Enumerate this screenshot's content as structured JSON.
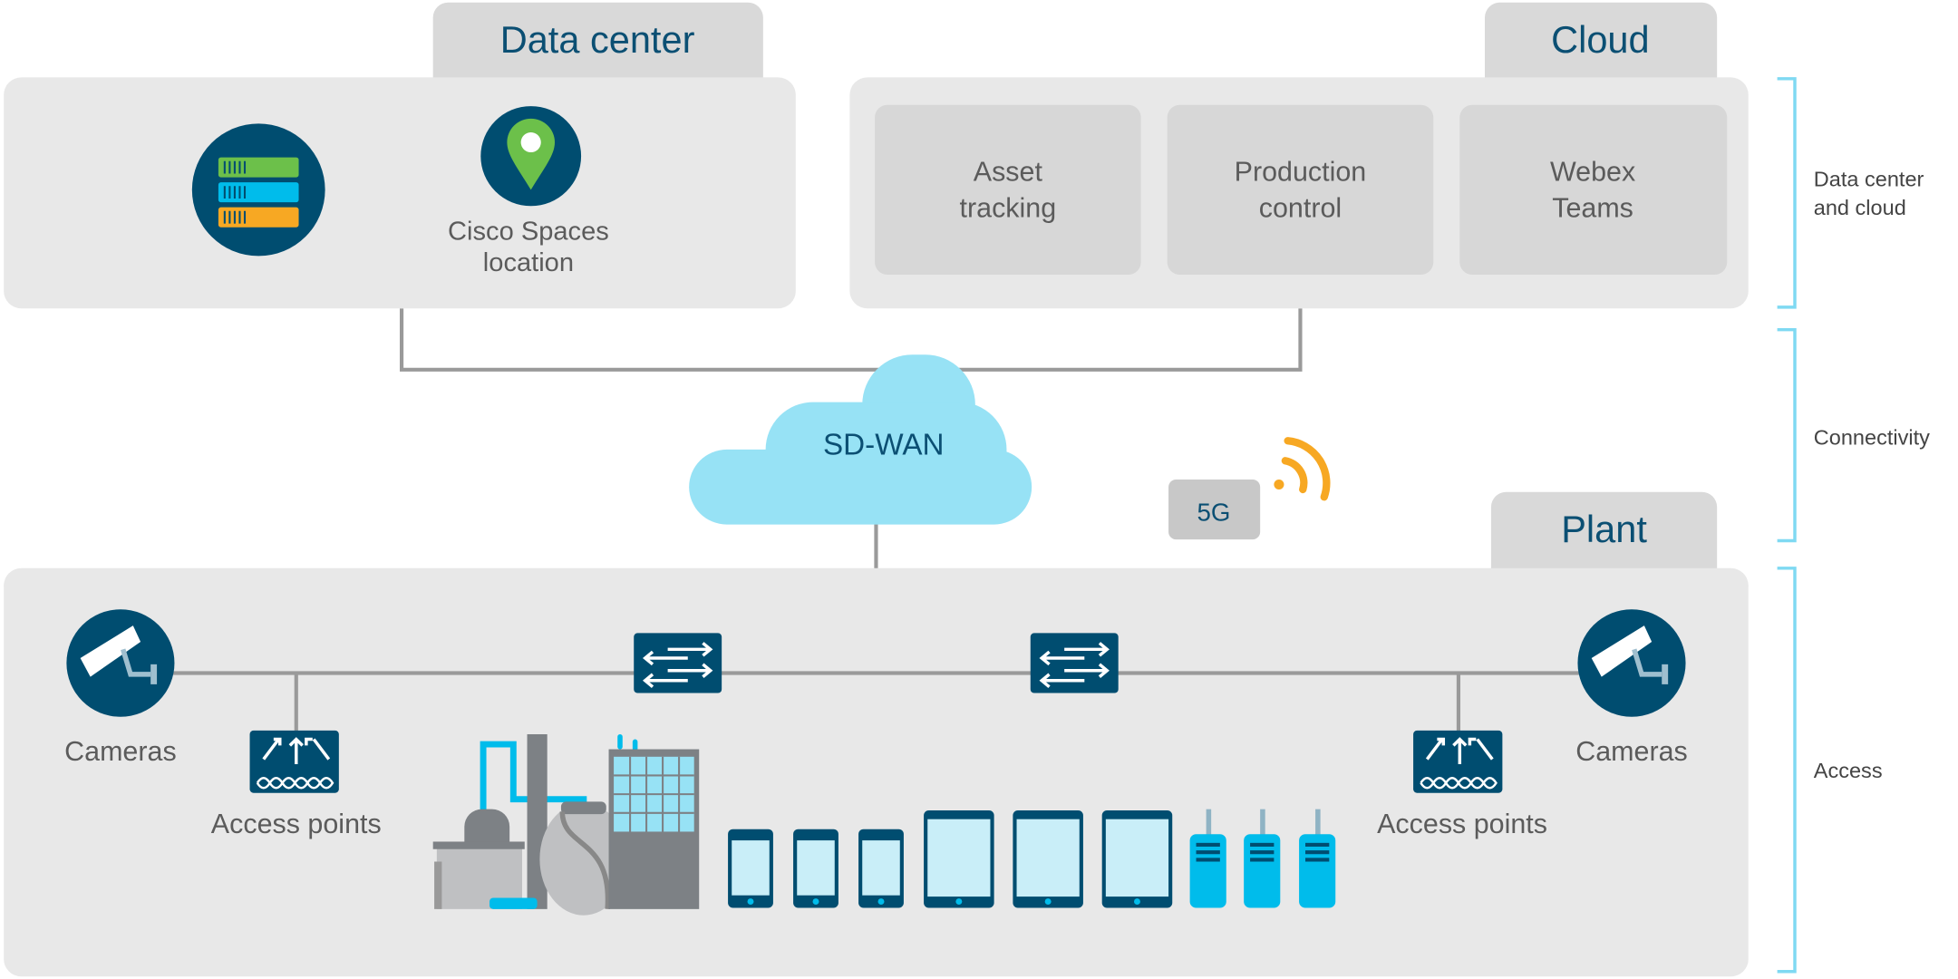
{
  "sections": {
    "data_center": {
      "title": "Data center",
      "location_label_1": "Cisco Spaces",
      "location_label_2": "location"
    },
    "cloud": {
      "title": "Cloud",
      "apps": [
        {
          "line1": "Asset",
          "line2": "tracking"
        },
        {
          "line1": "Production",
          "line2": "control"
        },
        {
          "line1": "Webex",
          "line2": "Teams"
        }
      ]
    },
    "connectivity": {
      "sdwan": "SD-WAN",
      "fiveg": "5G"
    },
    "plant": {
      "title": "Plant",
      "cameras_left": "Cameras",
      "cameras_right": "Cameras",
      "ap_left": "Access points",
      "ap_right": "Access points"
    }
  },
  "layers": [
    {
      "line1": "Data center",
      "line2": "and cloud"
    },
    {
      "line1": "Connectivity"
    },
    {
      "line1": "Access"
    }
  ],
  "colors": {
    "navy": "#004d70",
    "panel": "#e8e8e8",
    "tab": "#d9d9d9",
    "cloud": "#97e2f5",
    "bracket": "#7fd9f2",
    "orange": "#f7a823",
    "green": "#6cc04a",
    "cyan": "#00bceb"
  }
}
